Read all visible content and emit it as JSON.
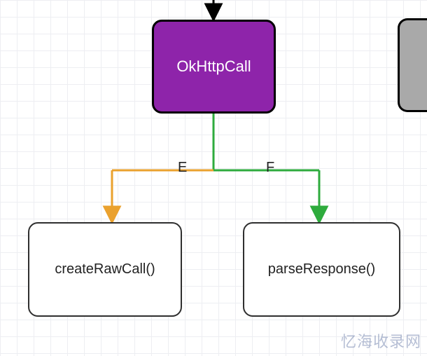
{
  "diagram": {
    "nodes": {
      "main": {
        "label": "OkHttpCall",
        "fill": "#8e24aa",
        "text": "#ffffff"
      },
      "left": {
        "label": "createRawCall()",
        "fill": "#ffffff",
        "text": "#222222"
      },
      "right": {
        "label": "parseResponse()",
        "fill": "#ffffff",
        "text": "#222222"
      },
      "side": {
        "label": "",
        "fill": "#a9a9a9"
      }
    },
    "edges": {
      "top_in": {
        "color": "#000000"
      },
      "stem": {
        "color": "#2eab3d"
      },
      "e": {
        "label": "E",
        "color": "#eaa12e"
      },
      "f": {
        "label": "F",
        "color": "#2eab3d"
      }
    }
  },
  "watermark": "忆海收录网"
}
